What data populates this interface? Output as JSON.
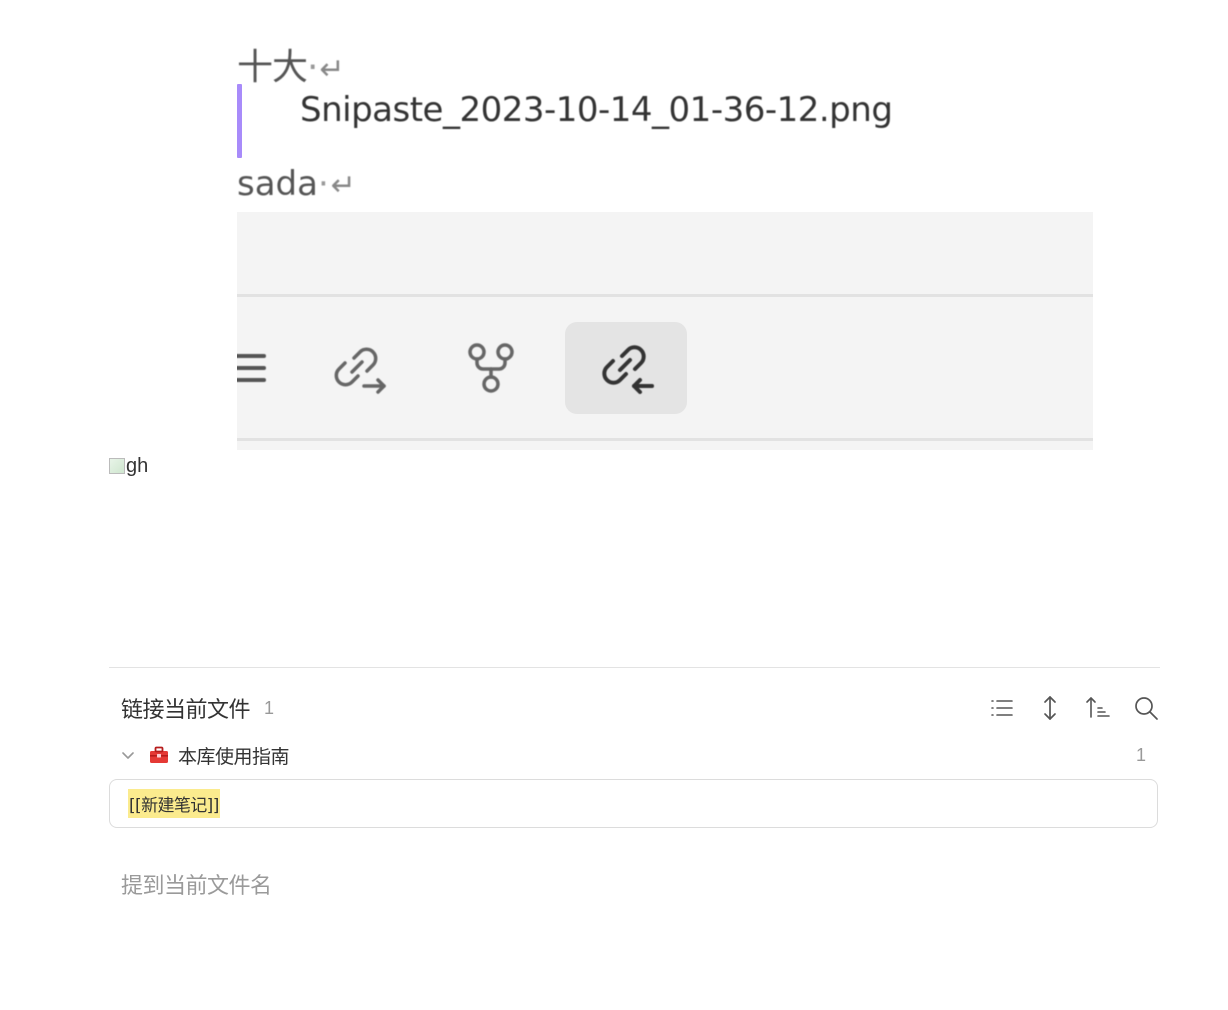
{
  "embedded_image": {
    "line1_text": "十大",
    "line1_marker": "·",
    "line1_return": "↵",
    "quote_filename": "Snipaste_2023-10-14_01-36-12.png",
    "line3_text": "sada",
    "line3_marker": "·",
    "line3_return": "↵",
    "toolbar_icons": [
      "list-icon",
      "outgoing-links-icon",
      "graph-icon",
      "backlinks-icon"
    ],
    "active_icon": "backlinks-icon"
  },
  "broken_image": {
    "alt": "gh"
  },
  "backlinks": {
    "title": "链接当前文件",
    "count": "1",
    "actions": [
      "list-view-icon",
      "expand-collapse-icon",
      "sort-icon",
      "search-icon"
    ],
    "file": {
      "name": "本库使用指南",
      "emoji": "toolbox-icon",
      "count": "1"
    },
    "match_text": "[[新建笔记]]",
    "unlinked_title": "提到当前文件名"
  },
  "colors": {
    "accent_quote": "#a88bfa",
    "highlight": "#fbeb8e",
    "toolbox_red": "#e53935"
  }
}
